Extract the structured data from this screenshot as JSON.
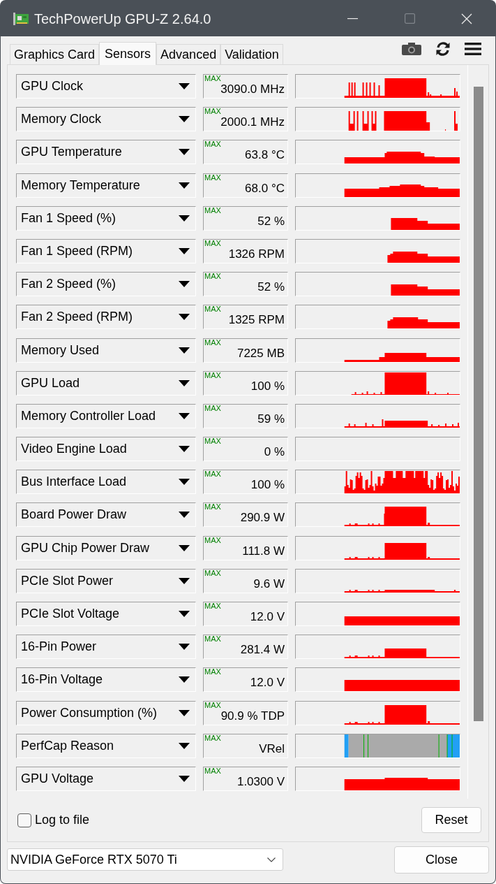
{
  "window": {
    "title": "TechPowerUp GPU-Z 2.64.0",
    "maximize_disabled": true
  },
  "tabs": [
    {
      "label": "Graphics Card",
      "selected": false
    },
    {
      "label": "Sensors",
      "selected": true
    },
    {
      "label": "Advanced",
      "selected": false
    },
    {
      "label": "Validation",
      "selected": false
    }
  ],
  "sensors": [
    {
      "name": "GPU Clock",
      "max_label": "MAX",
      "value": "3090.0 MHz"
    },
    {
      "name": "Memory Clock",
      "max_label": "MAX",
      "value": "2000.1 MHz"
    },
    {
      "name": "GPU Temperature",
      "max_label": "MAX",
      "value": "63.8 °C"
    },
    {
      "name": "Memory Temperature",
      "max_label": "MAX",
      "value": "68.0 °C"
    },
    {
      "name": "Fan 1 Speed (%)",
      "max_label": "MAX",
      "value": "52 %"
    },
    {
      "name": "Fan 1 Speed (RPM)",
      "max_label": "MAX",
      "value": "1326 RPM"
    },
    {
      "name": "Fan 2 Speed (%)",
      "max_label": "MAX",
      "value": "52 %"
    },
    {
      "name": "Fan 2 Speed (RPM)",
      "max_label": "MAX",
      "value": "1325 RPM"
    },
    {
      "name": "Memory Used",
      "max_label": "MAX",
      "value": "7225 MB"
    },
    {
      "name": "GPU Load",
      "max_label": "MAX",
      "value": "100 %"
    },
    {
      "name": "Memory Controller Load",
      "max_label": "MAX",
      "value": "59 %"
    },
    {
      "name": "Video Engine Load",
      "max_label": "MAX",
      "value": "0 %"
    },
    {
      "name": "Bus Interface Load",
      "max_label": "MAX",
      "value": "100 %"
    },
    {
      "name": "Board Power Draw",
      "max_label": "MAX",
      "value": "290.9 W"
    },
    {
      "name": "GPU Chip Power Draw",
      "max_label": "MAX",
      "value": "111.8 W"
    },
    {
      "name": "PCIe Slot Power",
      "max_label": "MAX",
      "value": "9.6 W"
    },
    {
      "name": "PCIe Slot Voltage",
      "max_label": "MAX",
      "value": "12.0 V"
    },
    {
      "name": "16-Pin Power",
      "max_label": "MAX",
      "value": "281.4 W"
    },
    {
      "name": "16-Pin Voltage",
      "max_label": "MAX",
      "value": "12.0 V"
    },
    {
      "name": "Power Consumption (%)",
      "max_label": "MAX",
      "value": "90.9 % TDP"
    },
    {
      "name": "PerfCap Reason",
      "max_label": "MAX",
      "value": "VRel"
    },
    {
      "name": "GPU Voltage",
      "max_label": "MAX",
      "value": "1.0300 V"
    }
  ],
  "log_to_file": {
    "label": "Log to file",
    "checked": false
  },
  "reset_button": "Reset",
  "gpu_select": {
    "value": "NVIDIA GeForce RTX 5070 Ti"
  },
  "close_button": "Close"
}
